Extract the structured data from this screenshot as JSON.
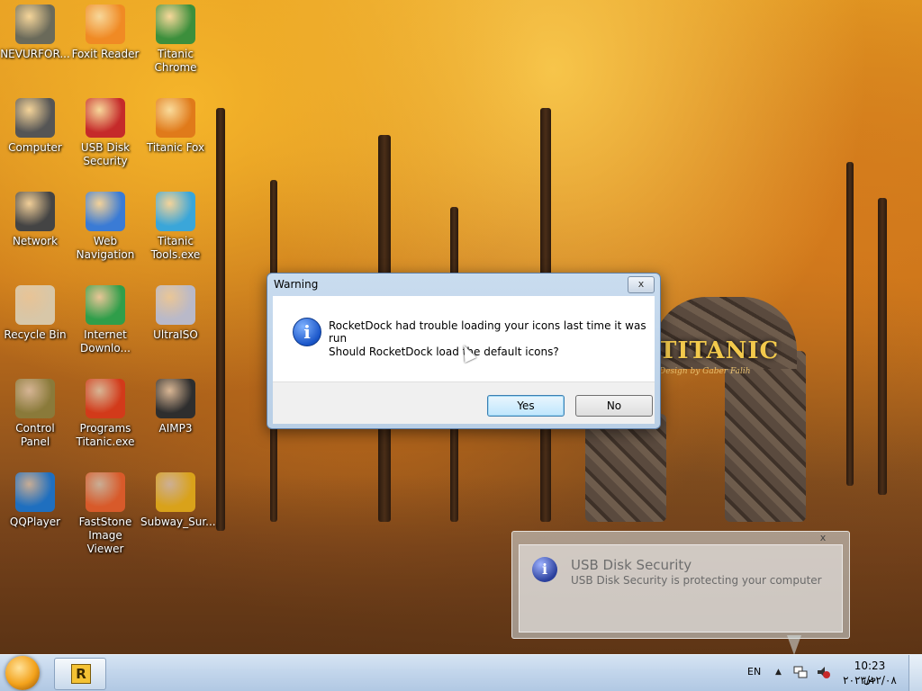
{
  "desktop_icons": [
    {
      "name": "nevurfor",
      "label": "NEVURFOR...",
      "icon": "gear-icon",
      "color": "#6a6a5a"
    },
    {
      "name": "foxit-reader",
      "label": "Foxit Reader",
      "icon": "pdf-icon",
      "color": "#f08a24"
    },
    {
      "name": "titanic-chrome",
      "label": "Titanic Chrome",
      "icon": "chrome-icon",
      "color": "#3c8f3c"
    },
    {
      "name": "computer",
      "label": "Computer",
      "icon": "computer-icon",
      "color": "#555"
    },
    {
      "name": "usb-disk-security",
      "label": "USB Disk Security",
      "icon": "shield-icon",
      "color": "#c52a2a"
    },
    {
      "name": "titanic-fox",
      "label": "Titanic Fox",
      "icon": "firefox-icon",
      "color": "#e07a1a"
    },
    {
      "name": "network",
      "label": "Network",
      "icon": "network-icon",
      "color": "#444"
    },
    {
      "name": "web-navigation",
      "label": "Web Navigation",
      "icon": "globe-icon",
      "color": "#3a7bd5"
    },
    {
      "name": "titanic-tools",
      "label": "Titanic Tools.exe",
      "icon": "tools-icon",
      "color": "#3aa6d9"
    },
    {
      "name": "recycle-bin",
      "label": "Recycle Bin",
      "icon": "recycle-bin-icon",
      "color": "#d8c7a8"
    },
    {
      "name": "internet-download",
      "label": "Internet Downlo...",
      "icon": "download-icon",
      "color": "#2f9e4a"
    },
    {
      "name": "ultraiso",
      "label": "UltraISO",
      "icon": "disc-icon",
      "color": "#b9b9c9"
    },
    {
      "name": "control-panel",
      "label": "Control Panel",
      "icon": "control-panel-icon",
      "color": "#8a7a3a"
    },
    {
      "name": "programs-titanic",
      "label": "Programs Titanic.exe",
      "icon": "fire-icon",
      "color": "#d23a1a"
    },
    {
      "name": "aimp3",
      "label": "AIMP3",
      "icon": "aimp-icon",
      "color": "#2e2e2e"
    },
    {
      "name": "qqplayer",
      "label": "QQPlayer",
      "icon": "qqplayer-icon",
      "color": "#1f6fbf"
    },
    {
      "name": "faststone",
      "label": "FastStone Image Viewer",
      "icon": "eye-icon",
      "color": "#d85a2a"
    },
    {
      "name": "subway-surfers",
      "label": "Subway_Sur...",
      "icon": "game-icon",
      "color": "#d9a21a"
    }
  ],
  "wallpaper": {
    "brand": "TITANIC",
    "tagline": "Design by Gaber Falih"
  },
  "dialog": {
    "title": "Warning",
    "close": "x",
    "info_glyph": "i",
    "message1": "RocketDock had trouble loading your icons last time it was run",
    "message2": "Should RocketDock load the default icons?",
    "yes": "Yes",
    "no": "No"
  },
  "notification": {
    "title": "USB Disk Security",
    "text": "USB Disk Security is protecting your computer",
    "close": "x",
    "glyph": "i"
  },
  "taskbar": {
    "language": "EN",
    "tray_up": "▲",
    "time": "10:23 ص",
    "date": "٢٠٢٣/١٢/٠٨",
    "task_letter": "R"
  }
}
